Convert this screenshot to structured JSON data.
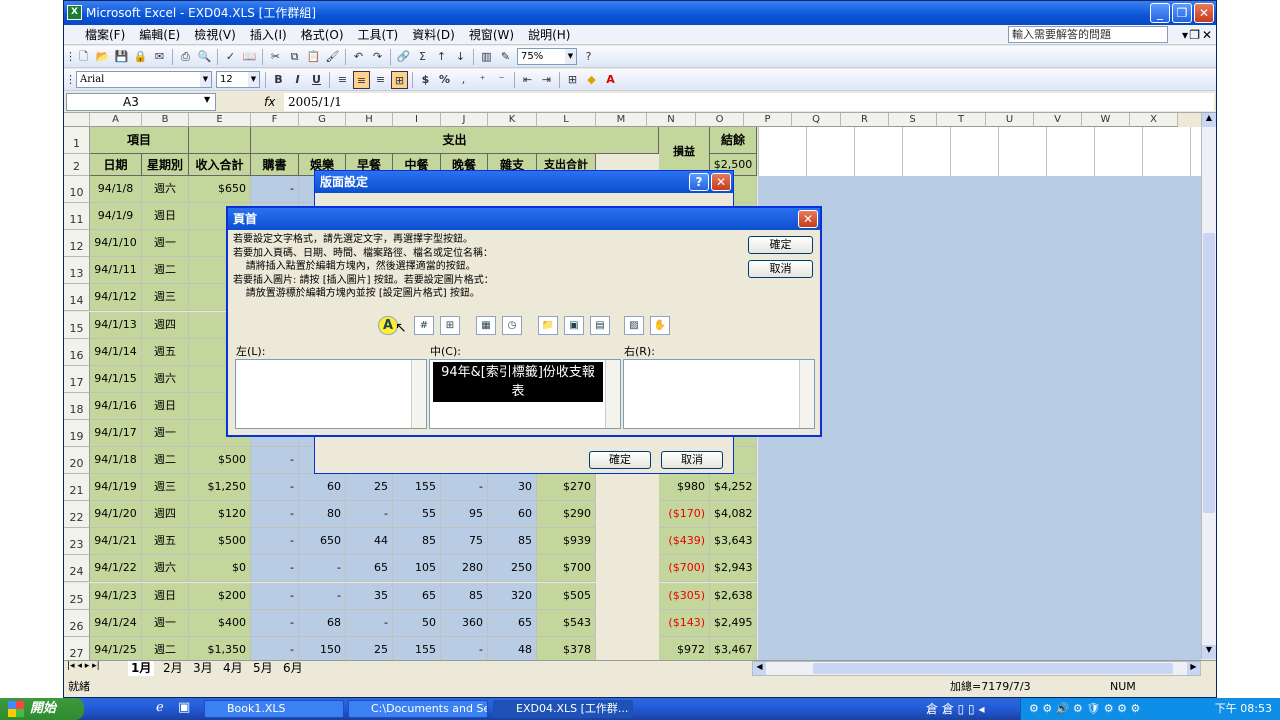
{
  "window": {
    "title": "Microsoft Excel - EXD04.XLS  [工作群組]",
    "app_icon": "X",
    "help_placeholder": "輸入需要解答的問題"
  },
  "menu": [
    "檔案(F)",
    "編輯(E)",
    "檢視(V)",
    "插入(I)",
    "格式(O)",
    "工具(T)",
    "資料(D)",
    "視窗(W)",
    "說明(H)"
  ],
  "toolbar": {
    "zoom": "75%",
    "font": "Arial",
    "size": "12",
    "bold": "B",
    "italic": "I",
    "underline": "U",
    "currency": "$",
    "percent": "%",
    "sum": "Σ"
  },
  "formula_bar": {
    "name_box": "A3",
    "fx": "fx",
    "value": "2005/1/1"
  },
  "columns": [
    "A",
    "B",
    "E",
    "F",
    "G",
    "H",
    "I",
    "J",
    "K",
    "L",
    "M",
    "N",
    "O",
    "P",
    "Q",
    "R",
    "S",
    "T",
    "U",
    "V",
    "W",
    "X"
  ],
  "headers": {
    "item": "項目",
    "expense": "支出",
    "balance_label": "結餘",
    "profit_loss": "損益",
    "date": "日期",
    "weekday": "星期別",
    "income_total": "收入合計",
    "shopping": "購書",
    "entertainment": "娛樂",
    "breakfast": "早餐",
    "lunch": "中餐",
    "dinner": "晚餐",
    "misc": "雜支",
    "expense_total": "支出合計",
    "start_balance": "$2,500"
  },
  "rows": [
    {
      "n": "10",
      "date": "94/1/8",
      "wd": "週六",
      "inc": "$650",
      "f": "-",
      "g": "",
      "h": "",
      "i": "",
      "j": "",
      "k": "",
      "l": "",
      "m": "",
      "nn": ""
    },
    {
      "n": "11",
      "date": "94/1/9",
      "wd": "週日",
      "inc": "",
      "f": "",
      "g": "",
      "h": "",
      "i": "",
      "j": "",
      "k": "",
      "l": "",
      "m": "",
      "nn": ""
    },
    {
      "n": "12",
      "date": "94/1/10",
      "wd": "週一",
      "inc": "$1,",
      "f": "",
      "g": "",
      "h": "",
      "i": "",
      "j": "",
      "k": "",
      "l": "",
      "m": "",
      "nn": ""
    },
    {
      "n": "13",
      "date": "94/1/11",
      "wd": "週二",
      "inc": "$2,",
      "f": "",
      "g": "",
      "h": "",
      "i": "",
      "j": "",
      "k": "",
      "l": "",
      "m": "",
      "nn": ""
    },
    {
      "n": "14",
      "date": "94/1/12",
      "wd": "週三",
      "inc": "$1,",
      "f": "",
      "g": "",
      "h": "",
      "i": "",
      "j": "",
      "k": "",
      "l": "",
      "m": "",
      "nn": ""
    },
    {
      "n": "15",
      "date": "94/1/13",
      "wd": "週四",
      "inc": "$1,",
      "f": "",
      "g": "",
      "h": "",
      "i": "",
      "j": "",
      "k": "",
      "l": "",
      "m": "",
      "nn": ""
    },
    {
      "n": "16",
      "date": "94/1/14",
      "wd": "週五",
      "inc": "$1,",
      "f": "",
      "g": "",
      "h": "",
      "i": "",
      "j": "",
      "k": "",
      "l": "",
      "m": "",
      "nn": ""
    },
    {
      "n": "17",
      "date": "94/1/15",
      "wd": "週六",
      "inc": "$2,",
      "f": "",
      "g": "",
      "h": "",
      "i": "",
      "j": "",
      "k": "",
      "l": "",
      "m": "",
      "nn": ""
    },
    {
      "n": "18",
      "date": "94/1/16",
      "wd": "週日",
      "inc": "$",
      "f": "",
      "g": "",
      "h": "",
      "i": "",
      "j": "",
      "k": "",
      "l": "",
      "m": "",
      "nn": ""
    },
    {
      "n": "19",
      "date": "94/1/17",
      "wd": "週一",
      "inc": "$1,",
      "f": "",
      "g": "",
      "h": "",
      "i": "",
      "j": "",
      "k": "",
      "l": "",
      "m": "",
      "nn": ""
    },
    {
      "n": "20",
      "date": "94/1/18",
      "wd": "週二",
      "inc": "$500",
      "f": "-",
      "g": "",
      "h": "",
      "i": "",
      "j": "",
      "k": "",
      "l": "",
      "m": "",
      "nn": ""
    },
    {
      "n": "21",
      "date": "94/1/19",
      "wd": "週三",
      "inc": "$1,250",
      "f": "-",
      "g": "60",
      "h": "25",
      "i": "155",
      "j": "-",
      "k": "30",
      "l": "$270",
      "m": "$980",
      "nn": "$4,252"
    },
    {
      "n": "22",
      "date": "94/1/20",
      "wd": "週四",
      "inc": "$120",
      "f": "-",
      "g": "80",
      "h": "-",
      "i": "55",
      "j": "95",
      "k": "60",
      "l": "$290",
      "m": "($170)",
      "nn": "$4,082"
    },
    {
      "n": "23",
      "date": "94/1/21",
      "wd": "週五",
      "inc": "$500",
      "f": "-",
      "g": "650",
      "h": "44",
      "i": "85",
      "j": "75",
      "k": "85",
      "l": "$939",
      "m": "($439)",
      "nn": "$3,643"
    },
    {
      "n": "24",
      "date": "94/1/22",
      "wd": "週六",
      "inc": "$0",
      "f": "-",
      "g": "-",
      "h": "65",
      "i": "105",
      "j": "280",
      "k": "250",
      "l": "$700",
      "m": "($700)",
      "nn": "$2,943"
    },
    {
      "n": "25",
      "date": "94/1/23",
      "wd": "週日",
      "inc": "$200",
      "f": "-",
      "g": "-",
      "h": "35",
      "i": "65",
      "j": "85",
      "k": "320",
      "l": "$505",
      "m": "($305)",
      "nn": "$2,638"
    },
    {
      "n": "26",
      "date": "94/1/24",
      "wd": "週一",
      "inc": "$400",
      "f": "-",
      "g": "68",
      "h": "-",
      "i": "50",
      "j": "360",
      "k": "65",
      "l": "$543",
      "m": "($143)",
      "nn": "$2,495"
    },
    {
      "n": "27",
      "date": "94/1/25",
      "wd": "週二",
      "inc": "$1,350",
      "f": "-",
      "g": "150",
      "h": "25",
      "i": "155",
      "j": "-",
      "k": "48",
      "l": "$378",
      "m": "$972",
      "nn": "$3,467"
    }
  ],
  "sheet_tabs": [
    "1月",
    "2月",
    "3月",
    "4月",
    "5月",
    "6月"
  ],
  "status": {
    "left": "就緒",
    "sum": "加總=7179/7/3",
    "num": "NUM"
  },
  "page_setup_dialog": {
    "title": "版面設定",
    "ok": "確定",
    "cancel": "取消"
  },
  "header_dialog": {
    "title": "頁首",
    "instructions": "若要設定文字格式，請先選定文字，再選擇字型按鈕。\n若要加入頁碼、日期、時間、檔案路徑、檔名或定位名稱：\n    請將插入點置於編輯方塊內，然後選擇適當的按鈕。\n若要插入圖片: 請按 [插入圖片] 按鈕。若要設定圖片格式：\n    請放置游標於編輯方塊內並按 [設定圖片格式] 按鈕。",
    "ok": "確定",
    "cancel": "取消",
    "left_label": "左(L):",
    "center_label": "中(C):",
    "right_label": "右(R):",
    "center_text": "94年&[索引標籤]份收支報表",
    "font_button": "A"
  },
  "taskbar": {
    "start": "開始",
    "tasks": [
      "Book1.XLS",
      "C:\\Documents and Sett...",
      "EXD04.XLS [工作群..."
    ],
    "clock": "下午 08:53"
  }
}
